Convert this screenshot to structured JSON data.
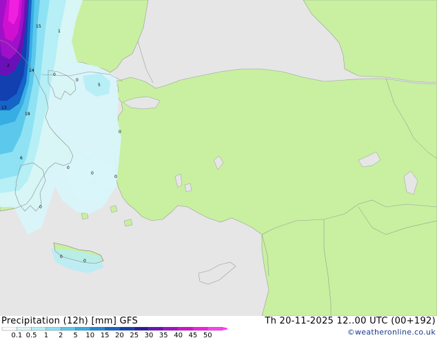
{
  "legend": {
    "title": "Precipitation (12h) [mm] GFS",
    "valid": "Th 20-11-2025 12..00 UTC (00+192)",
    "credit": "©weatheronline.co.uk",
    "scale_values": [
      "0.1",
      "0.5",
      "1",
      "2",
      "5",
      "10",
      "15",
      "20",
      "25",
      "30",
      "35",
      "40",
      "45",
      "50"
    ],
    "scale_colors": [
      "#ffffff",
      "#d8f6fa",
      "#b4eef6",
      "#8ce0f2",
      "#5cc8ec",
      "#36aee4",
      "#1e8ad8",
      "#1664c8",
      "#1240b0",
      "#2a1aa0",
      "#6a10b8",
      "#a010c8",
      "#d010d0",
      "#f020e0",
      "#ff40f0"
    ]
  },
  "colors": {
    "sea": "#e8e8e8",
    "land": "#c8f0a0",
    "border": "#888888",
    "coast": "#999999"
  },
  "map_labels": [
    "15",
    "1",
    "2",
    "14",
    "0",
    "0",
    "5",
    "13",
    "18",
    "0",
    "6",
    "0",
    "0",
    "0",
    "0",
    "0",
    "0"
  ]
}
